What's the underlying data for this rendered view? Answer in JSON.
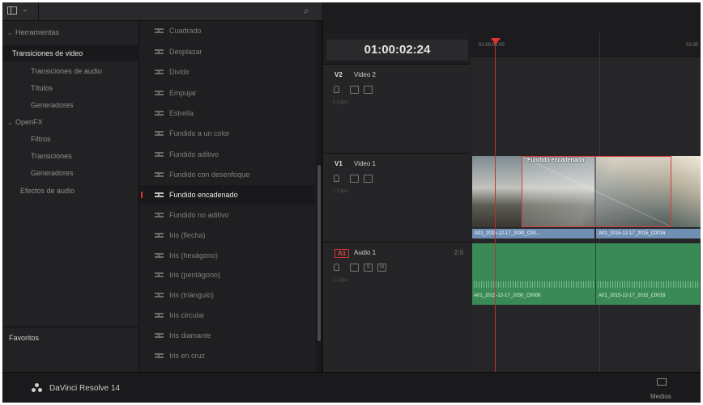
{
  "sidebar": {
    "items": [
      {
        "label": "Herramientas",
        "caret": "⌄",
        "selected": false,
        "indent": 0
      },
      {
        "label": "Transiciones de video",
        "selected": true,
        "indent": 1
      },
      {
        "label": "Transiciones de audio",
        "selected": false,
        "indent": 1
      },
      {
        "label": "Títulos",
        "selected": false,
        "indent": 1
      },
      {
        "label": "Generadores",
        "selected": false,
        "indent": 1
      },
      {
        "label": "OpenFX",
        "caret": "⌄",
        "selected": false,
        "indent": 0
      },
      {
        "label": "Filtros",
        "selected": false,
        "indent": 1
      },
      {
        "label": "Transiciones",
        "selected": false,
        "indent": 1
      },
      {
        "label": "Generadores",
        "selected": false,
        "indent": 1
      },
      {
        "label": "Efectos de audio",
        "selected": false,
        "indent": 0
      }
    ],
    "favorites_label": "Favoritos"
  },
  "transitions": [
    "Cuadrado",
    "Desplazar",
    "Dividir",
    "Empujar",
    "Estrella",
    "Fundido a un color",
    "Fundido aditivo",
    "Fundido con desenfoque",
    "Fundido encadenado",
    "Fundido no aditivo",
    "Iris (flecha)",
    "Iris (hexágono)",
    "Iris (pentágono)",
    "Iris (triángulo)",
    "Iris circular",
    "Iris diamante",
    "Iris en cruz"
  ],
  "selected_transition": "Fundido encadenado",
  "timecode": "01:00:02:24",
  "ruler": {
    "left_tick": "01:00:02:00",
    "right_tick": "01:00"
  },
  "tracks": {
    "v2": {
      "id": "V2",
      "name": "Video 2",
      "sub": "0 Clips"
    },
    "v1": {
      "id": "V1",
      "name": "Video 1",
      "sub": "2 Clips"
    },
    "a1": {
      "id": "A1",
      "name": "Audio 1",
      "channels": "2.0",
      "sub": "2 Clips",
      "solo": "S",
      "mute": "M"
    }
  },
  "clips": {
    "transition_label": "Fundido encadenado",
    "video_left": "A01_2015-12-17_2030_C00...",
    "video_right": "A01_2015-12-17_2015_C0016",
    "audio_left": "A01_2015-12-17_2030_C0006",
    "audio_right": "A01_2015-12-17_2015_C0016"
  },
  "bottom": {
    "brand": "DaVinci Resolve 14",
    "media_label": "Medios"
  },
  "icons": {
    "panel": "panel-toggle-icon",
    "search": "search-icon",
    "transition": "transition-icon",
    "lock": "lock-icon",
    "media": "media-icon",
    "logo": "davinci-logo-icon"
  },
  "colors": {
    "playhead": "#e0352f",
    "video_clip": "#6f8fb3",
    "audio_clip": "#3a8a57",
    "selection": "#d6403d"
  }
}
